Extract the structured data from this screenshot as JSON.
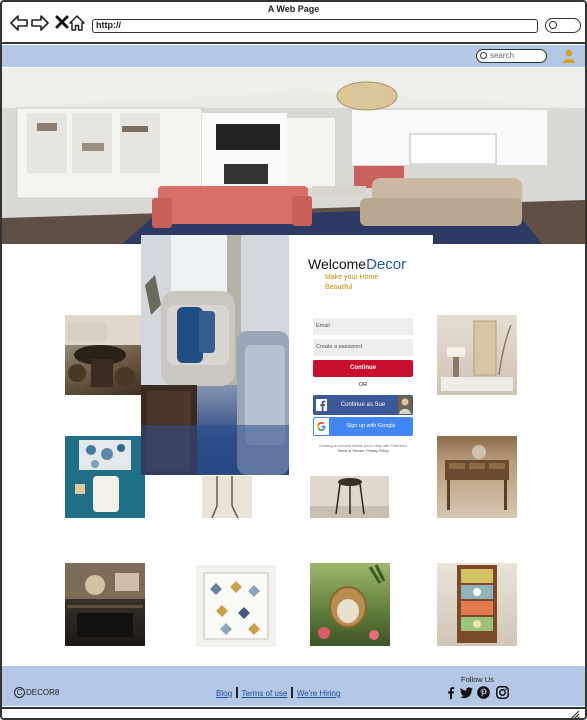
{
  "browser": {
    "window_title": "A Web Page",
    "url": "http://"
  },
  "site_header": {
    "search_placeholder": "search"
  },
  "signup": {
    "welcome": "Welcome",
    "brand": "Decor",
    "tagline": "Make your Home Beautiful",
    "email_placeholder": "Email",
    "password_placeholder": "Create a password",
    "continue_label": "Continue",
    "or_label": "OR",
    "facebook_label": "Continue as Sue",
    "google_label": "Sign up with Google",
    "legal_pre": "Creating an account means you're okay with Pinterest's ",
    "terms_link": "Terms of Service",
    "legal_mid": ", ",
    "privacy_link": "Privacy Policy"
  },
  "footer": {
    "copyright_symbol": "C",
    "brand": "DECOR8",
    "links": [
      "Blog",
      "Terms of use",
      "We're Hiring"
    ],
    "follow_us": "Follow Us"
  },
  "colors": {
    "header_bar": "#b4c7e7",
    "continue_button": "#c8102e",
    "facebook_button": "#3b5998",
    "google_button": "#4285f4",
    "brand_blue": "#1f5aa6",
    "tagline_gold": "#c68b00"
  },
  "icons": [
    "back-arrow-icon",
    "forward-arrow-icon",
    "close-icon",
    "home-icon",
    "search-icon",
    "user-icon",
    "facebook-icon",
    "google-icon",
    "twitter-icon",
    "pinterest-icon",
    "instagram-icon"
  ]
}
